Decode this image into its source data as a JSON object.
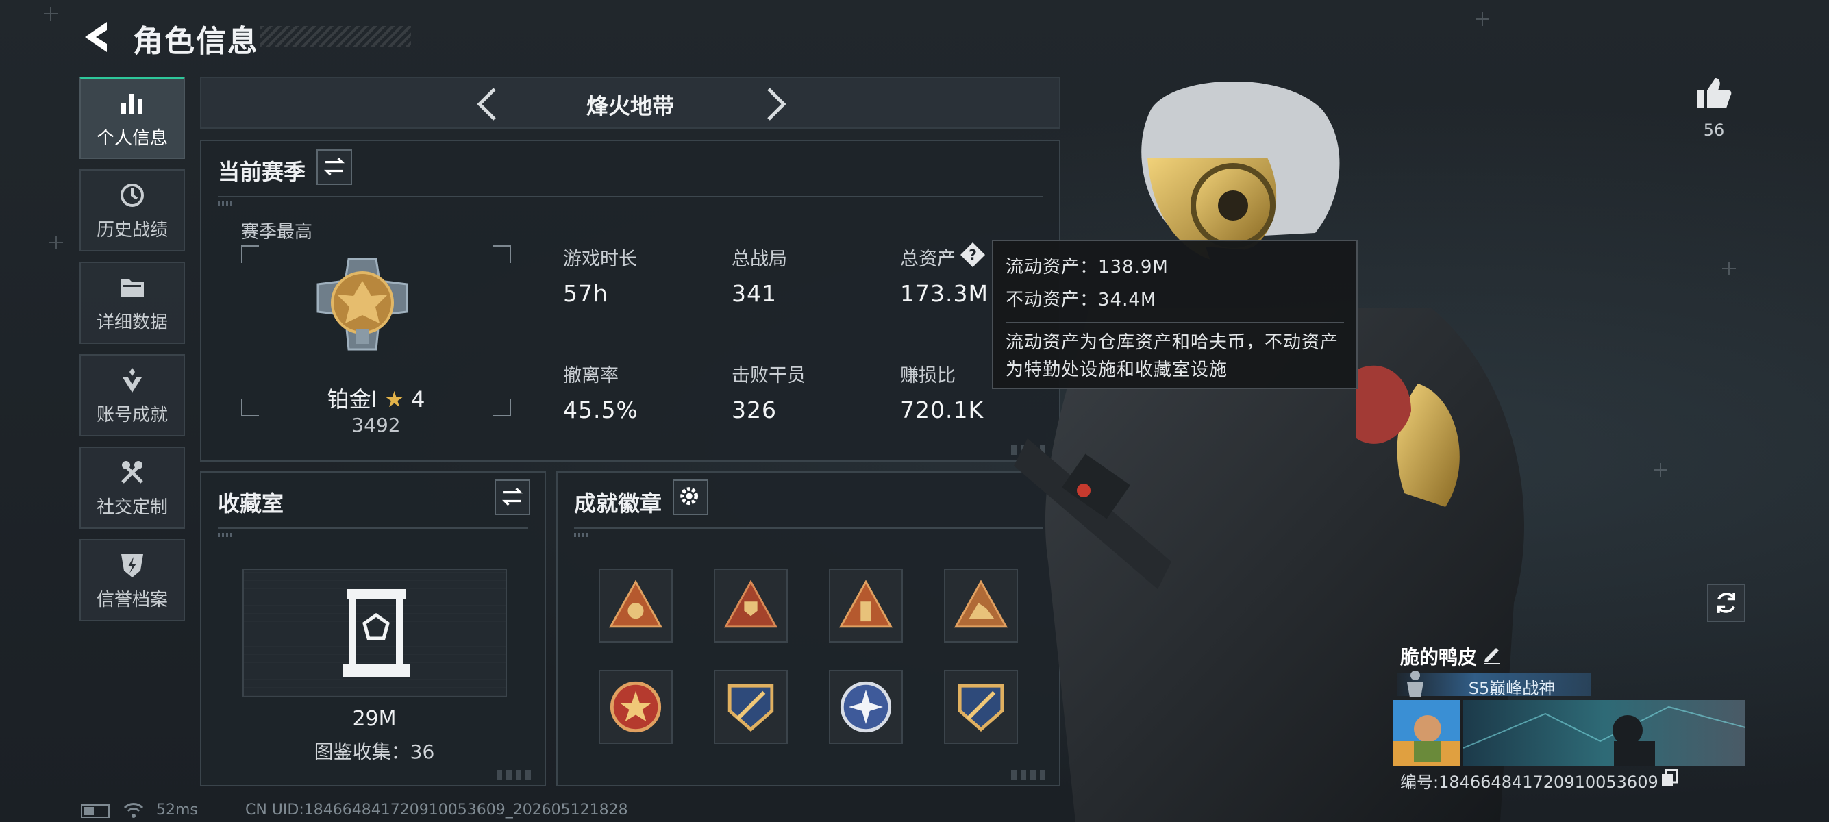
{
  "header": {
    "title": "角色信息"
  },
  "sidebar": {
    "items": [
      {
        "label": "个人信息",
        "icon": "bar-chart-icon",
        "active": true
      },
      {
        "label": "历史战绩",
        "icon": "history-icon",
        "active": false
      },
      {
        "label": "详细数据",
        "icon": "folder-icon",
        "active": false
      },
      {
        "label": "账号成就",
        "icon": "achievement-icon",
        "active": false
      },
      {
        "label": "社交定制",
        "icon": "tools-icon",
        "active": false
      },
      {
        "label": "信誉档案",
        "icon": "shield-icon",
        "active": false
      }
    ]
  },
  "mode_bar": {
    "title": "烽火地带"
  },
  "season": {
    "heading": "当前赛季",
    "best_label": "赛季最高",
    "rank_name": "铂金Ⅰ",
    "rank_stars": "4",
    "rank_score": "3492",
    "stats": [
      {
        "label": "游戏时长",
        "value": "57h"
      },
      {
        "label": "总战局",
        "value": "341"
      },
      {
        "label": "总资产",
        "value": "173.3M"
      },
      {
        "label": "撤离率",
        "value": "45.5%"
      },
      {
        "label": "击败干员",
        "value": "326"
      },
      {
        "label": "赚损比",
        "value": "720.1K"
      }
    ]
  },
  "tooltip": {
    "liquid": "流动资产：138.9M",
    "fixed": "不动资产：34.4M",
    "desc_line1": "流动资产为仓库资产和哈夫币，不动资产",
    "desc_line2": "为特勤处设施和收藏室设施"
  },
  "collection": {
    "heading": "收藏室",
    "value": "29M",
    "count": "图鉴收集：36"
  },
  "badges": {
    "heading": "成就徽章",
    "items": [
      {
        "icon": "triangle-medal-icon",
        "color": "#b5592e"
      },
      {
        "icon": "triangle-trophy-icon",
        "color": "#a4432b"
      },
      {
        "icon": "triangle-tower-icon",
        "color": "#b5592e"
      },
      {
        "icon": "triangle-beast-icon",
        "color": "#b06a36"
      },
      {
        "icon": "round-star-emblem-icon",
        "color": "#b53a2e"
      },
      {
        "icon": "shield-blade-emblem-icon",
        "color": "#2e4a7a"
      },
      {
        "icon": "round-star-blue-emblem-icon",
        "color": "#3e5a9a"
      },
      {
        "icon": "shield-blade-emblem-icon",
        "color": "#2e4a7a"
      }
    ]
  },
  "profile": {
    "likes": "56",
    "name": "脆的鸭皮",
    "title_badge": "S5巅峰战神",
    "player_id": "编号:1846648417209100536​09"
  },
  "status": {
    "battery_level": 0.45,
    "ping": "52ms",
    "uid": "CN UID:1846648417209100536​09_202605121828"
  },
  "colors": {
    "accent": "#2ec79a",
    "panel": "#1e2429",
    "tooltip_bg": "#16181a"
  }
}
